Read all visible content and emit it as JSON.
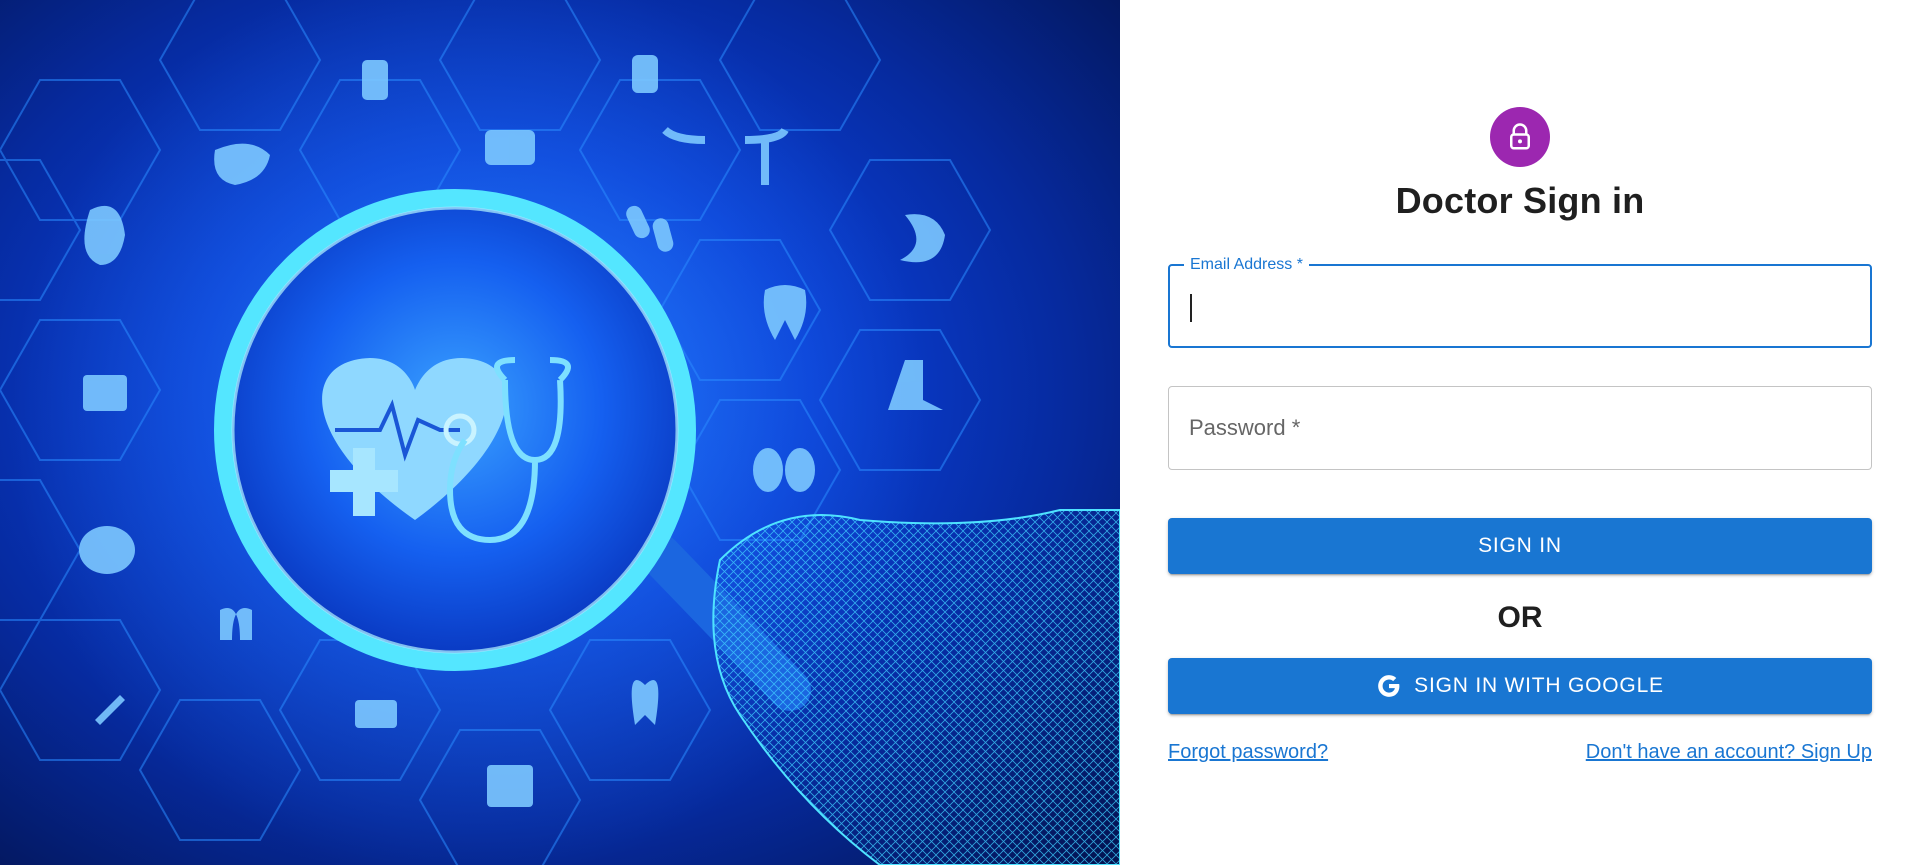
{
  "hero": {
    "image_name": "medical-icons-magnifier-illustration",
    "colors": {
      "deep": "#03134f",
      "mid": "#0a3fd6",
      "glow": "#5fe8ff",
      "icon": "#8fd8ff"
    }
  },
  "signin": {
    "lock_icon": "lock-icon",
    "avatar_color": "#9c27b0",
    "title": "Doctor Sign in",
    "email_label": "Email Address *",
    "email_value": "",
    "password_label": "Password *",
    "password_value": "",
    "signin_button": "SIGN IN",
    "or_text": "OR",
    "google_button": "SIGN IN WITH GOOGLE",
    "google_icon": "google-g-icon",
    "forgot_link": "Forgot password?",
    "signup_link": "Don't have an account? Sign Up",
    "accent_color": "#1976d2"
  }
}
